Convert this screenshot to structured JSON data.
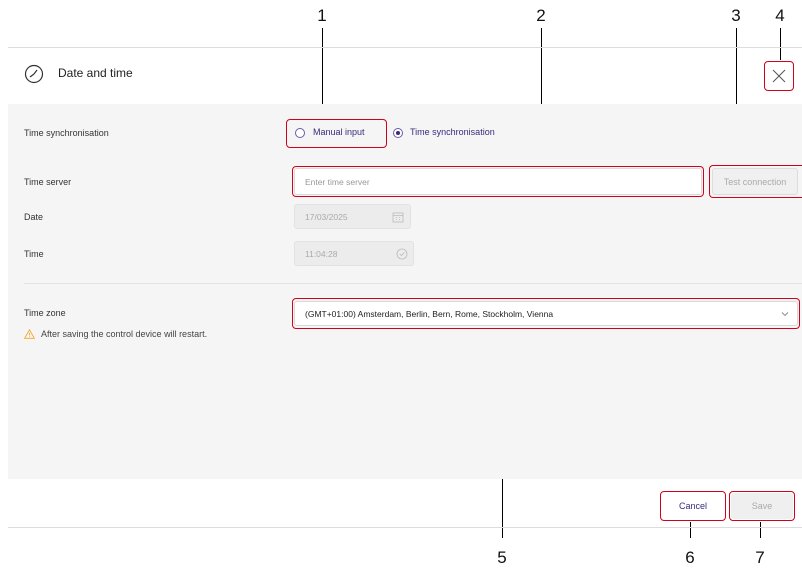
{
  "dialog": {
    "title": "Date and time",
    "close_icon": "close-icon",
    "header_icon": "clock-icon"
  },
  "form": {
    "sync": {
      "label": "Time synchronisation",
      "options": [
        {
          "label": "Manual input",
          "selected": false
        },
        {
          "label": "Time synchronisation",
          "selected": true
        }
      ]
    },
    "server": {
      "label": "Time server",
      "placeholder": "Enter time server",
      "test_button": "Test connection"
    },
    "date": {
      "label": "Date",
      "value": "17/03/2025",
      "icon": "calendar-icon"
    },
    "time": {
      "label": "Time",
      "value": "11:04:28",
      "icon": "clock-icon"
    },
    "timezone": {
      "label": "Time zone",
      "warning": "After saving the control device will restart.",
      "warning_icon": "warning-icon",
      "selected": "(GMT+01:00) Amsterdam, Berlin, Bern, Rome, Stockholm, Vienna",
      "chevron_icon": "chevron-down-icon"
    }
  },
  "footer": {
    "cancel": "Cancel",
    "save": "Save"
  },
  "callouts": [
    "1",
    "2",
    "3",
    "4",
    "5",
    "6",
    "7"
  ],
  "colors": {
    "accent": "#3b2a7a",
    "highlight": "#d0021b",
    "warning": "#f5a623",
    "panel": "#f5f5f5"
  }
}
